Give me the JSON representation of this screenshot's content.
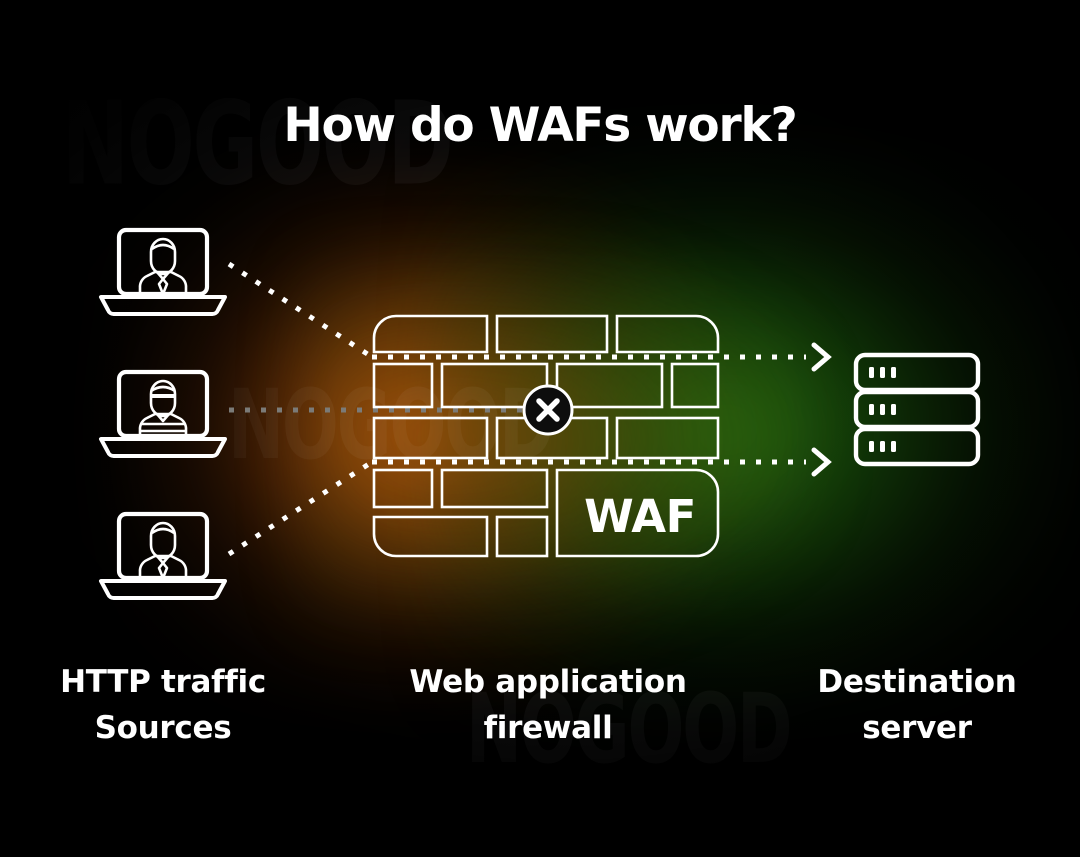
{
  "page": {
    "title": "How do WAFs work?",
    "watermark_text": "NOGOOD",
    "background": {
      "base_color": "#000000",
      "glow_left_color": "#be5c0c",
      "glow_right_color": "#288012",
      "stroke_color": "#ffffff"
    }
  },
  "columns": {
    "left": {
      "line1": "HTTP traffic",
      "line2": "Sources"
    },
    "middle": {
      "line1": "Web application",
      "line2": "firewall"
    },
    "right": {
      "line1": "Destination",
      "line2": "server"
    }
  },
  "firewall": {
    "label": "WAF",
    "blocked_marker": "×",
    "brick_count": 15
  },
  "sources": [
    {
      "id": "source-1",
      "type": "legitimate-user",
      "status": "allowed",
      "icon": "laptop-user-icon"
    },
    {
      "id": "source-2",
      "type": "attacker",
      "status": "blocked",
      "icon": "laptop-hacker-icon"
    },
    {
      "id": "source-3",
      "type": "legitimate-user",
      "status": "allowed",
      "icon": "laptop-user-icon"
    }
  ],
  "flows": [
    {
      "from": "source-1",
      "to": "destination-server",
      "state": "allowed",
      "style": "dotted-white"
    },
    {
      "from": "source-2",
      "to": "firewall",
      "state": "blocked",
      "style": "dotted-gray"
    },
    {
      "from": "source-3",
      "to": "destination-server",
      "state": "allowed",
      "style": "dotted-white"
    }
  ],
  "destination": {
    "id": "destination-server",
    "icon": "server-stack-icon",
    "unit_count": 3,
    "indicators_per_unit": 3
  }
}
